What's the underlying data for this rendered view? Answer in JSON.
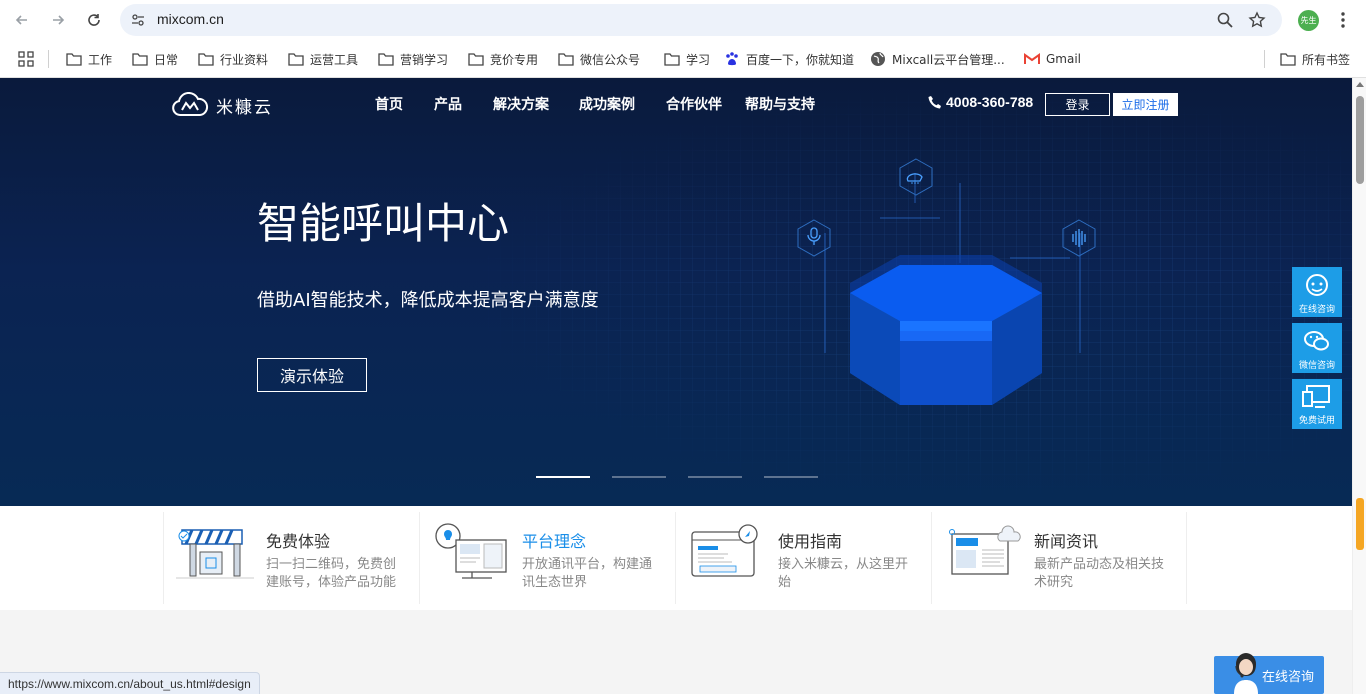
{
  "browser": {
    "url": "mixcom.cn",
    "profile_label": "先生",
    "status_url": "https://www.mixcom.cn/about_us.html#design"
  },
  "bookmarks": [
    {
      "label": "工作",
      "icon": "folder-icon"
    },
    {
      "label": "日常",
      "icon": "folder-icon"
    },
    {
      "label": "行业资料",
      "icon": "folder-icon"
    },
    {
      "label": "运营工具",
      "icon": "folder-icon"
    },
    {
      "label": "营销学习",
      "icon": "folder-icon"
    },
    {
      "label": "竞价专用",
      "icon": "folder-icon"
    },
    {
      "label": "微信公众号",
      "icon": "folder-icon"
    },
    {
      "label": "学习",
      "icon": "folder-icon"
    },
    {
      "label": "百度一下，你就知道",
      "icon": "baidu-icon"
    },
    {
      "label": "Mixcall云平台管理...",
      "icon": "globe-icon"
    },
    {
      "label": "Gmail",
      "icon": "gmail-icon"
    }
  ],
  "all_bookmarks_label": "所有书签",
  "site": {
    "logo_text": "米糠云",
    "nav": [
      "首页",
      "产品",
      "解决方案",
      "成功案例",
      "合作伙伴",
      "帮助与支持"
    ],
    "phone": "4008-360-788",
    "login_label": "登录",
    "register_label": "立即注册",
    "hero": {
      "title": "智能呼叫中心",
      "subtitle": "借助AI智能技术，降低成本提高客户满意度",
      "button": "演示体验"
    },
    "floating": [
      {
        "label": "在线咨询",
        "icon": "headset-icon"
      },
      {
        "label": "微信咨询",
        "icon": "wechat-icon"
      },
      {
        "label": "免费试用",
        "icon": "monitor-icon"
      }
    ],
    "features": [
      {
        "title": "免费体验",
        "desc": "扫一扫二维码，免费创建账号，体验产品功能",
        "highlight": false
      },
      {
        "title": "平台理念",
        "desc": "开放通讯平台，构建通讯生态世界",
        "highlight": true
      },
      {
        "title": "使用指南",
        "desc": "接入米糠云，从这里开始",
        "highlight": false
      },
      {
        "title": "新闻资讯",
        "desc": "最新产品动态及相关技术研究",
        "highlight": false
      }
    ],
    "online_chat_label": "在线咨询"
  },
  "colors": {
    "hero_bg": "#0b2352",
    "accent": "#1a8ee8",
    "float_btn": "#1d9de7"
  }
}
